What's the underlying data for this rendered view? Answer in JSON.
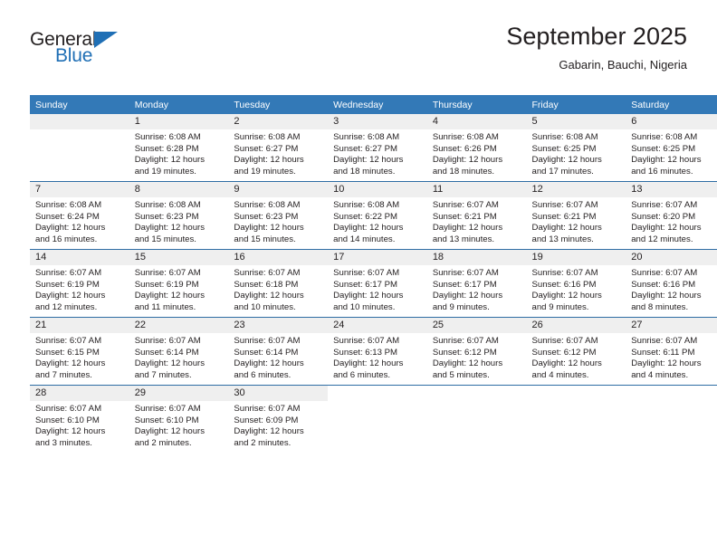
{
  "brand": {
    "name_part1": "General",
    "name_part2": "Blue",
    "triangle_icon": "triangle-logo-icon",
    "accent_color": "#1f6fb5"
  },
  "header": {
    "title": "September 2025",
    "location": "Gabarin, Bauchi, Nigeria"
  },
  "colors": {
    "header_row": "#3379b7",
    "row_divider": "#2e6da4",
    "daynum_band": "#efefef",
    "text": "#231f20"
  },
  "weekday_headers": [
    "Sunday",
    "Monday",
    "Tuesday",
    "Wednesday",
    "Thursday",
    "Friday",
    "Saturday"
  ],
  "weeks": [
    [
      {
        "day": "",
        "sunrise": "",
        "sunset": "",
        "daylight1": "",
        "daylight2": "",
        "empty": true
      },
      {
        "day": "1",
        "sunrise": "Sunrise: 6:08 AM",
        "sunset": "Sunset: 6:28 PM",
        "daylight1": "Daylight: 12 hours",
        "daylight2": "and 19 minutes."
      },
      {
        "day": "2",
        "sunrise": "Sunrise: 6:08 AM",
        "sunset": "Sunset: 6:27 PM",
        "daylight1": "Daylight: 12 hours",
        "daylight2": "and 19 minutes."
      },
      {
        "day": "3",
        "sunrise": "Sunrise: 6:08 AM",
        "sunset": "Sunset: 6:27 PM",
        "daylight1": "Daylight: 12 hours",
        "daylight2": "and 18 minutes."
      },
      {
        "day": "4",
        "sunrise": "Sunrise: 6:08 AM",
        "sunset": "Sunset: 6:26 PM",
        "daylight1": "Daylight: 12 hours",
        "daylight2": "and 18 minutes."
      },
      {
        "day": "5",
        "sunrise": "Sunrise: 6:08 AM",
        "sunset": "Sunset: 6:25 PM",
        "daylight1": "Daylight: 12 hours",
        "daylight2": "and 17 minutes."
      },
      {
        "day": "6",
        "sunrise": "Sunrise: 6:08 AM",
        "sunset": "Sunset: 6:25 PM",
        "daylight1": "Daylight: 12 hours",
        "daylight2": "and 16 minutes."
      }
    ],
    [
      {
        "day": "7",
        "sunrise": "Sunrise: 6:08 AM",
        "sunset": "Sunset: 6:24 PM",
        "daylight1": "Daylight: 12 hours",
        "daylight2": "and 16 minutes."
      },
      {
        "day": "8",
        "sunrise": "Sunrise: 6:08 AM",
        "sunset": "Sunset: 6:23 PM",
        "daylight1": "Daylight: 12 hours",
        "daylight2": "and 15 minutes."
      },
      {
        "day": "9",
        "sunrise": "Sunrise: 6:08 AM",
        "sunset": "Sunset: 6:23 PM",
        "daylight1": "Daylight: 12 hours",
        "daylight2": "and 15 minutes."
      },
      {
        "day": "10",
        "sunrise": "Sunrise: 6:08 AM",
        "sunset": "Sunset: 6:22 PM",
        "daylight1": "Daylight: 12 hours",
        "daylight2": "and 14 minutes."
      },
      {
        "day": "11",
        "sunrise": "Sunrise: 6:07 AM",
        "sunset": "Sunset: 6:21 PM",
        "daylight1": "Daylight: 12 hours",
        "daylight2": "and 13 minutes."
      },
      {
        "day": "12",
        "sunrise": "Sunrise: 6:07 AM",
        "sunset": "Sunset: 6:21 PM",
        "daylight1": "Daylight: 12 hours",
        "daylight2": "and 13 minutes."
      },
      {
        "day": "13",
        "sunrise": "Sunrise: 6:07 AM",
        "sunset": "Sunset: 6:20 PM",
        "daylight1": "Daylight: 12 hours",
        "daylight2": "and 12 minutes."
      }
    ],
    [
      {
        "day": "14",
        "sunrise": "Sunrise: 6:07 AM",
        "sunset": "Sunset: 6:19 PM",
        "daylight1": "Daylight: 12 hours",
        "daylight2": "and 12 minutes."
      },
      {
        "day": "15",
        "sunrise": "Sunrise: 6:07 AM",
        "sunset": "Sunset: 6:19 PM",
        "daylight1": "Daylight: 12 hours",
        "daylight2": "and 11 minutes."
      },
      {
        "day": "16",
        "sunrise": "Sunrise: 6:07 AM",
        "sunset": "Sunset: 6:18 PM",
        "daylight1": "Daylight: 12 hours",
        "daylight2": "and 10 minutes."
      },
      {
        "day": "17",
        "sunrise": "Sunrise: 6:07 AM",
        "sunset": "Sunset: 6:17 PM",
        "daylight1": "Daylight: 12 hours",
        "daylight2": "and 10 minutes."
      },
      {
        "day": "18",
        "sunrise": "Sunrise: 6:07 AM",
        "sunset": "Sunset: 6:17 PM",
        "daylight1": "Daylight: 12 hours",
        "daylight2": "and 9 minutes."
      },
      {
        "day": "19",
        "sunrise": "Sunrise: 6:07 AM",
        "sunset": "Sunset: 6:16 PM",
        "daylight1": "Daylight: 12 hours",
        "daylight2": "and 9 minutes."
      },
      {
        "day": "20",
        "sunrise": "Sunrise: 6:07 AM",
        "sunset": "Sunset: 6:16 PM",
        "daylight1": "Daylight: 12 hours",
        "daylight2": "and 8 minutes."
      }
    ],
    [
      {
        "day": "21",
        "sunrise": "Sunrise: 6:07 AM",
        "sunset": "Sunset: 6:15 PM",
        "daylight1": "Daylight: 12 hours",
        "daylight2": "and 7 minutes."
      },
      {
        "day": "22",
        "sunrise": "Sunrise: 6:07 AM",
        "sunset": "Sunset: 6:14 PM",
        "daylight1": "Daylight: 12 hours",
        "daylight2": "and 7 minutes."
      },
      {
        "day": "23",
        "sunrise": "Sunrise: 6:07 AM",
        "sunset": "Sunset: 6:14 PM",
        "daylight1": "Daylight: 12 hours",
        "daylight2": "and 6 minutes."
      },
      {
        "day": "24",
        "sunrise": "Sunrise: 6:07 AM",
        "sunset": "Sunset: 6:13 PM",
        "daylight1": "Daylight: 12 hours",
        "daylight2": "and 6 minutes."
      },
      {
        "day": "25",
        "sunrise": "Sunrise: 6:07 AM",
        "sunset": "Sunset: 6:12 PM",
        "daylight1": "Daylight: 12 hours",
        "daylight2": "and 5 minutes."
      },
      {
        "day": "26",
        "sunrise": "Sunrise: 6:07 AM",
        "sunset": "Sunset: 6:12 PM",
        "daylight1": "Daylight: 12 hours",
        "daylight2": "and 4 minutes."
      },
      {
        "day": "27",
        "sunrise": "Sunrise: 6:07 AM",
        "sunset": "Sunset: 6:11 PM",
        "daylight1": "Daylight: 12 hours",
        "daylight2": "and 4 minutes."
      }
    ],
    [
      {
        "day": "28",
        "sunrise": "Sunrise: 6:07 AM",
        "sunset": "Sunset: 6:10 PM",
        "daylight1": "Daylight: 12 hours",
        "daylight2": "and 3 minutes."
      },
      {
        "day": "29",
        "sunrise": "Sunrise: 6:07 AM",
        "sunset": "Sunset: 6:10 PM",
        "daylight1": "Daylight: 12 hours",
        "daylight2": "and 2 minutes."
      },
      {
        "day": "30",
        "sunrise": "Sunrise: 6:07 AM",
        "sunset": "Sunset: 6:09 PM",
        "daylight1": "Daylight: 12 hours",
        "daylight2": "and 2 minutes."
      },
      {
        "day": "",
        "sunrise": "",
        "sunset": "",
        "daylight1": "",
        "daylight2": "",
        "blank": true
      },
      {
        "day": "",
        "sunrise": "",
        "sunset": "",
        "daylight1": "",
        "daylight2": "",
        "blank": true
      },
      {
        "day": "",
        "sunrise": "",
        "sunset": "",
        "daylight1": "",
        "daylight2": "",
        "blank": true
      },
      {
        "day": "",
        "sunrise": "",
        "sunset": "",
        "daylight1": "",
        "daylight2": "",
        "blank": true
      }
    ]
  ]
}
